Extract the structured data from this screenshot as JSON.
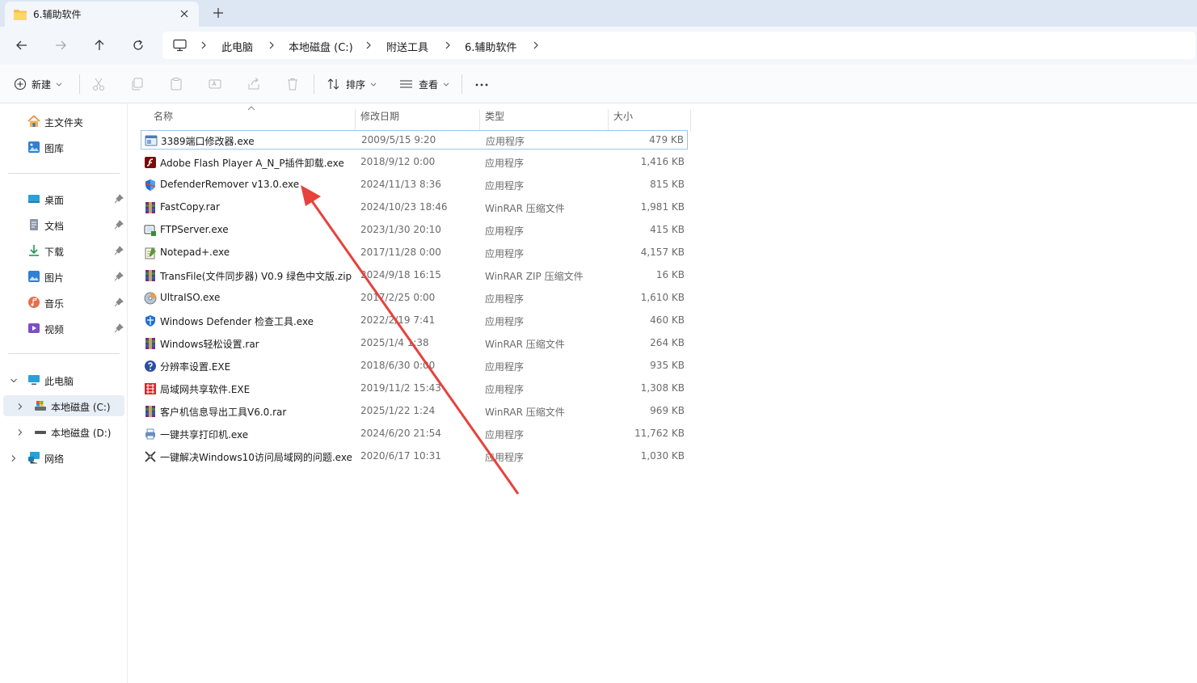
{
  "tab": {
    "title": "6.辅助软件"
  },
  "breadcrumb": [
    "此电脑",
    "本地磁盘 (C:)",
    "附送工具",
    "6.辅助软件"
  ],
  "toolbar": {
    "new_label": "新建",
    "sort_label": "排序",
    "view_label": "查看"
  },
  "sidebar": {
    "top": [
      {
        "label": "主文件夹",
        "icon": "home-icon"
      },
      {
        "label": "图库",
        "icon": "gallery-icon"
      }
    ],
    "quick": [
      {
        "label": "桌面",
        "icon": "desktop-icon"
      },
      {
        "label": "文档",
        "icon": "documents-icon"
      },
      {
        "label": "下载",
        "icon": "download-icon"
      },
      {
        "label": "图片",
        "icon": "pictures-icon"
      },
      {
        "label": "音乐",
        "icon": "music-icon"
      },
      {
        "label": "视频",
        "icon": "videos-icon"
      }
    ],
    "tree": [
      {
        "label": "此电脑",
        "icon": "this-pc-icon"
      },
      {
        "label": "本地磁盘 (C:)",
        "icon": "drive-c-icon"
      },
      {
        "label": "本地磁盘 (D:)",
        "icon": "drive-d-icon"
      },
      {
        "label": "网络",
        "icon": "network-icon"
      }
    ]
  },
  "columns": {
    "name": "名称",
    "date": "修改日期",
    "type": "类型",
    "size": "大小"
  },
  "files": [
    {
      "name": "3389端口修改器.exe",
      "date": "2009/5/15 9:20",
      "type": "应用程序",
      "size": "479 KB",
      "icon": "app-window-icon"
    },
    {
      "name": "Adobe Flash Player A_N_P插件卸载.exe",
      "date": "2018/9/12 0:00",
      "type": "应用程序",
      "size": "1,416 KB",
      "icon": "flash-icon"
    },
    {
      "name": "DefenderRemover v13.0.exe",
      "date": "2024/11/13 8:36",
      "type": "应用程序",
      "size": "815 KB",
      "icon": "shield-icon"
    },
    {
      "name": "FastCopy.rar",
      "date": "2024/10/23 18:46",
      "type": "WinRAR 压缩文件",
      "size": "1,981 KB",
      "icon": "winrar-icon"
    },
    {
      "name": "FTPServer.exe",
      "date": "2023/1/30 20:10",
      "type": "应用程序",
      "size": "415 KB",
      "icon": "ftp-server-icon"
    },
    {
      "name": "Notepad+.exe",
      "date": "2017/11/28 0:00",
      "type": "应用程序",
      "size": "4,157 KB",
      "icon": "notepad-icon"
    },
    {
      "name": "TransFile(文件同步器) V0.9 绿色中文版.zip",
      "date": "2024/9/18 16:15",
      "type": "WinRAR ZIP 压缩文件",
      "size": "16 KB",
      "icon": "winrar-icon"
    },
    {
      "name": "UltraISO.exe",
      "date": "2017/2/25 0:00",
      "type": "应用程序",
      "size": "1,610 KB",
      "icon": "disc-icon"
    },
    {
      "name": "Windows Defender 检查工具.exe",
      "date": "2022/2/19 7:41",
      "type": "应用程序",
      "size": "460 KB",
      "icon": "defender-icon"
    },
    {
      "name": "Windows轻松设置.rar",
      "date": "2025/1/4 1:38",
      "type": "WinRAR 压缩文件",
      "size": "264 KB",
      "icon": "winrar-icon"
    },
    {
      "name": "分辨率设置.EXE",
      "date": "2018/6/30 0:00",
      "type": "应用程序",
      "size": "935 KB",
      "icon": "help-icon"
    },
    {
      "name": "局域网共享软件.EXE",
      "date": "2019/11/2 15:43",
      "type": "应用程序",
      "size": "1,308 KB",
      "icon": "lan-share-icon"
    },
    {
      "name": "客户机信息导出工具V6.0.rar",
      "date": "2025/1/22 1:24",
      "type": "WinRAR 压缩文件",
      "size": "969 KB",
      "icon": "winrar-icon"
    },
    {
      "name": "一键共享打印机.exe",
      "date": "2024/6/20 21:54",
      "type": "应用程序",
      "size": "11,762 KB",
      "icon": "printer-share-icon"
    },
    {
      "name": "一键解决Windows10访问局域网的问题.exe",
      "date": "2020/6/17 10:31",
      "type": "应用程序",
      "size": "1,030 KB",
      "icon": "tools-icon"
    }
  ],
  "colors": {
    "accent": "#0067c0",
    "arrow": "#e8413b",
    "selection_border": "#9fc2e8"
  }
}
